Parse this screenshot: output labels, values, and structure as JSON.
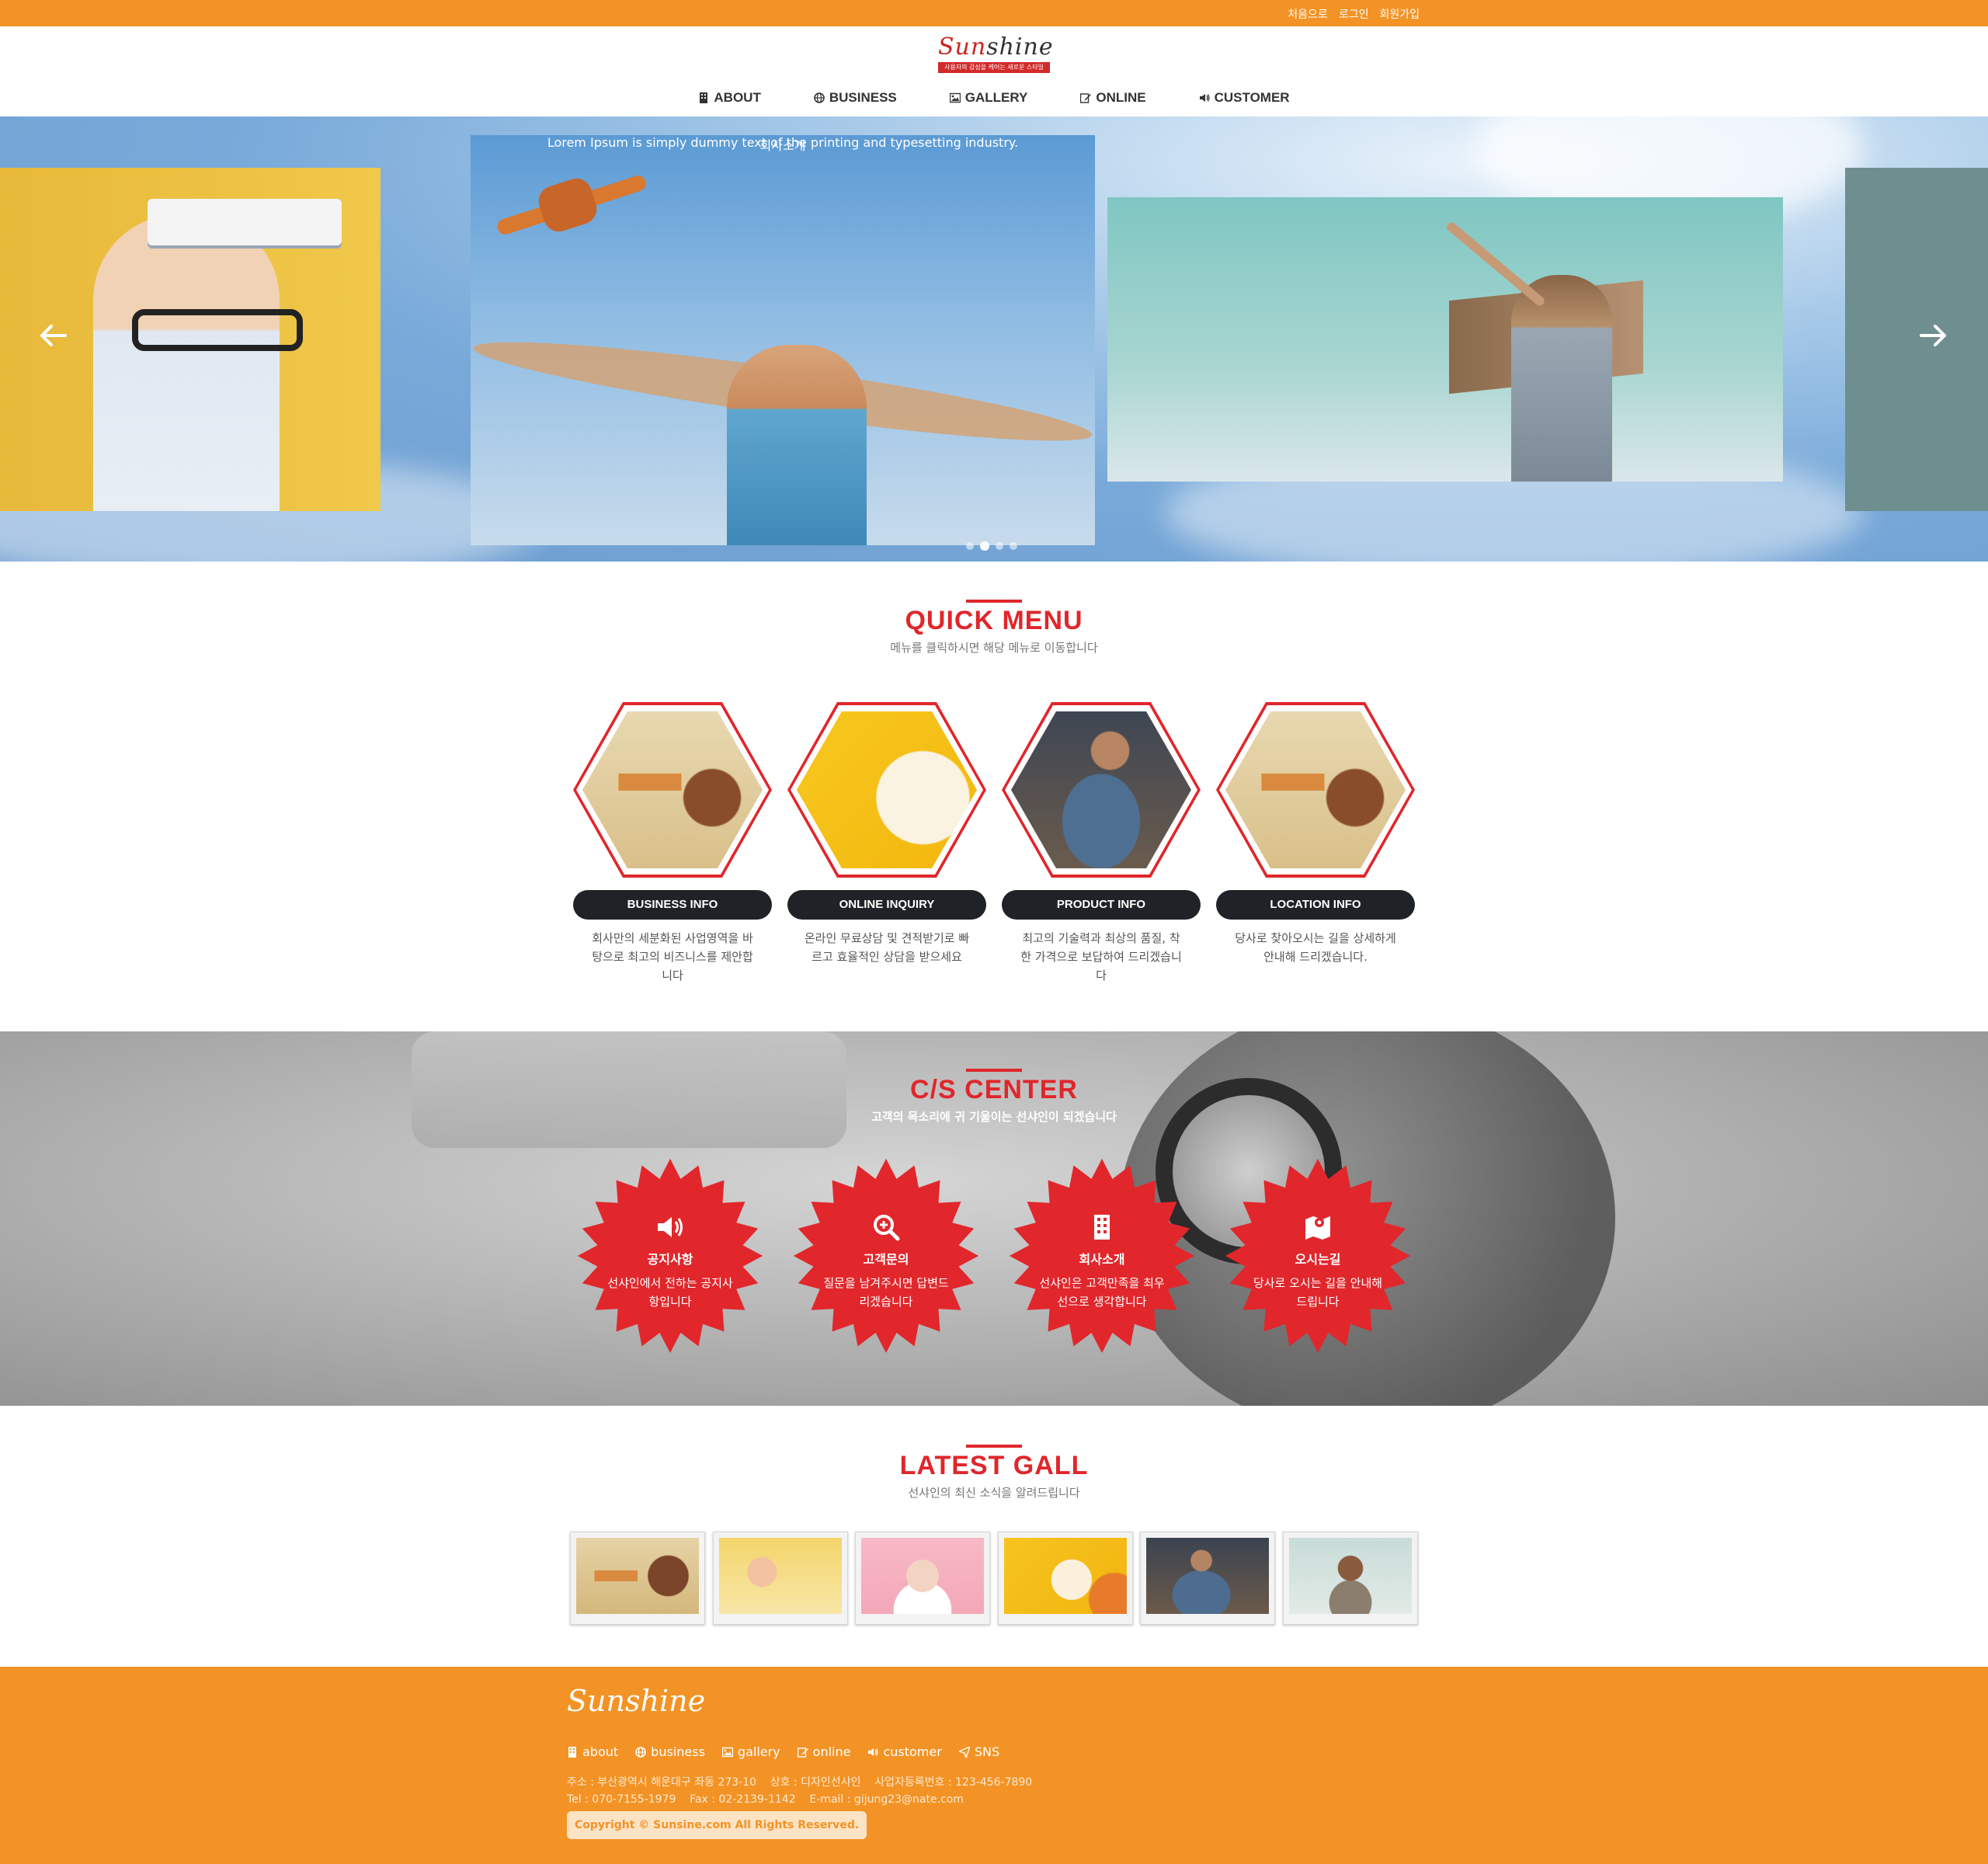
{
  "topbar": {
    "links": [
      "처음으로",
      "로그인",
      "회원가입"
    ]
  },
  "header": {
    "logo_text_a": "Sun",
    "logo_text_b": "shine",
    "logo_tagline": "사용자의 감성을 케어는 새로운 스타일",
    "nav": [
      {
        "label": "ABOUT",
        "icon": "building-icon"
      },
      {
        "label": "BUSINESS",
        "icon": "globe-icon"
      },
      {
        "label": "GALLERY",
        "icon": "image-icon"
      },
      {
        "label": "ONLINE",
        "icon": "edit-icon"
      },
      {
        "label": "CUSTOMER",
        "icon": "speaker-icon"
      }
    ]
  },
  "hero": {
    "caption_title": "회사소개",
    "caption_text": "Lorem Ipsum is simply dummy text of the printing and typesetting industry.",
    "active_slide": 2,
    "slide_count": 4
  },
  "quick_menu": {
    "title": "QUICK MENU",
    "subtitle": "메뉴를 클릭하시면 해당 메뉴로 이동합니다",
    "items": [
      {
        "button": "BUSINESS INFO",
        "desc": "회사만의 세분화된 사업영역을 바탕으로 최고의 비즈니스를 제안합니다"
      },
      {
        "button": "ONLINE INQUIRY",
        "desc": "온라인 무료상담 및 견적받기로 빠르고 효율적인 상담을 받으세요"
      },
      {
        "button": "PRODUCT INFO",
        "desc": "최고의 기술력과 최상의 품질, 착한 가격으로 보답하여 드리겠습니다"
      },
      {
        "button": "LOCATION INFO",
        "desc": "당사로 찾아오시는 길을 상세하게 안내해 드리겠습니다."
      }
    ]
  },
  "cs_center": {
    "title": "C/S CENTER",
    "subtitle": "고객의 목소리에 귀 기울이는 선샤인이 되겠습니다",
    "items": [
      {
        "icon": "speaker-icon",
        "title": "공지사항",
        "desc": "선샤인에서 전하는 공지사항입니다"
      },
      {
        "icon": "search-plus-icon",
        "title": "고객문의",
        "desc": "질문을 남겨주시면 답변드리겠습니다"
      },
      {
        "icon": "building-icon",
        "title": "회사소개",
        "desc": "선샤인은 고객만족을 최우선으로 생각합니다"
      },
      {
        "icon": "map-icon",
        "title": "오시는길",
        "desc": "당사로 오시는 길을 안내해 드립니다"
      }
    ]
  },
  "latest_gall": {
    "title": "LATEST GALL",
    "subtitle": "선샤인의 최신 소식을 알려드립니다",
    "thumb_count": 6
  },
  "footer": {
    "logo": "Sunshine",
    "nav": [
      {
        "label": "about",
        "icon": "building-icon"
      },
      {
        "label": "business",
        "icon": "globe-icon"
      },
      {
        "label": "gallery",
        "icon": "image-icon"
      },
      {
        "label": "online",
        "icon": "edit-icon"
      },
      {
        "label": "customer",
        "icon": "speaker-icon"
      },
      {
        "label": "SNS",
        "icon": "send-icon"
      }
    ],
    "address_line": "주소 : 부산광역시 해운대구 좌동 273-10    상호 : 디자인선샤인    사업자등록번호 : 123-456-7890",
    "contact_line": "Tel : 070-7155-1979    Fax : 02-2139-1142    E-mail : gijung23@nate.com",
    "copyright": "Copyright © Sunsine.com All Rights Reserved."
  },
  "colors": {
    "orange": "#f39325",
    "red": "#e0262b",
    "dark": "#1f2226"
  }
}
